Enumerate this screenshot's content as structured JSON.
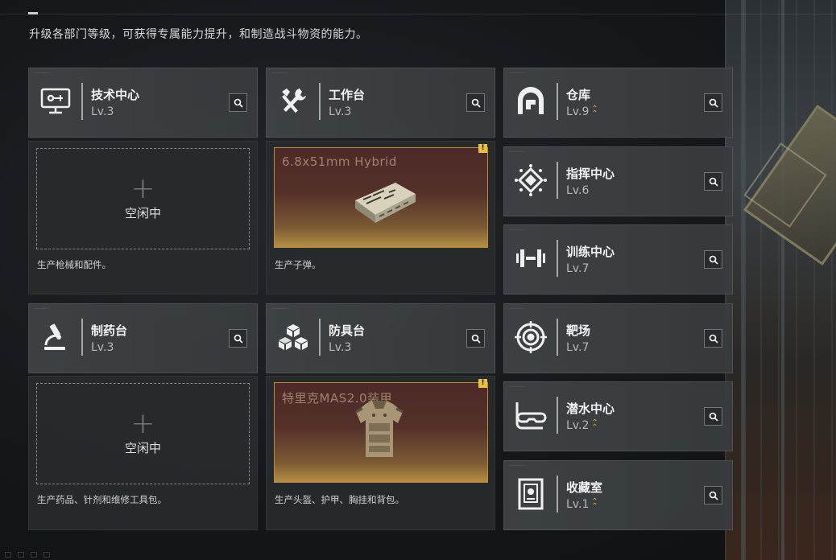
{
  "header": {
    "intro": "升级各部门等级，可获得专属能力提升，和制造战斗物资的能力。"
  },
  "departments": {
    "tech_center": {
      "name": "技术中心",
      "level": "Lv.3",
      "icon": "monitor-icon",
      "upgradeable": false
    },
    "workbench": {
      "name": "工作台",
      "level": "Lv.3",
      "icon": "tools-icon",
      "upgradeable": false
    },
    "pharmacy": {
      "name": "制药台",
      "level": "Lv.3",
      "icon": "microscope-icon",
      "upgradeable": false
    },
    "armor_bench": {
      "name": "防具台",
      "level": "Lv.3",
      "icon": "cubes-icon",
      "upgradeable": false
    },
    "warehouse": {
      "name": "仓库",
      "level": "Lv.9",
      "icon": "vault-icon",
      "upgradeable": true
    },
    "command_center": {
      "name": "指挥中心",
      "level": "Lv.6",
      "icon": "chip-icon",
      "upgradeable": false
    },
    "training_center": {
      "name": "训练中心",
      "level": "Lv.7",
      "icon": "dumbbell-icon",
      "upgradeable": false
    },
    "shooting_range": {
      "name": "靶场",
      "level": "Lv.7",
      "icon": "target-icon",
      "upgradeable": false
    },
    "diving_center": {
      "name": "潜水中心",
      "level": "Lv.2",
      "icon": "diving-mask-icon",
      "upgradeable": true
    },
    "collection_room": {
      "name": "收藏室",
      "level": "Lv.1",
      "icon": "display-case-icon",
      "upgradeable": true
    }
  },
  "production": {
    "tech_center": {
      "status": "空闲中",
      "desc": "生产枪械和配件。"
    },
    "workbench": {
      "item": "6.8x51mm Hybrid",
      "desc": "生产子弹。",
      "item_icon": "ammo-box-icon"
    },
    "pharmacy": {
      "status": "空闲中",
      "desc": "生产药品、针剂和维修工具包。"
    },
    "armor_bench": {
      "item": "特里克MAS2.0装甲",
      "desc": "生产头盔、护甲、胸挂和背包。",
      "item_icon": "body-armor-icon"
    }
  },
  "colors": {
    "upgrade_arrow": "#d4a94c",
    "warning": "#e7c23b",
    "production_border": "#b98a3a"
  }
}
